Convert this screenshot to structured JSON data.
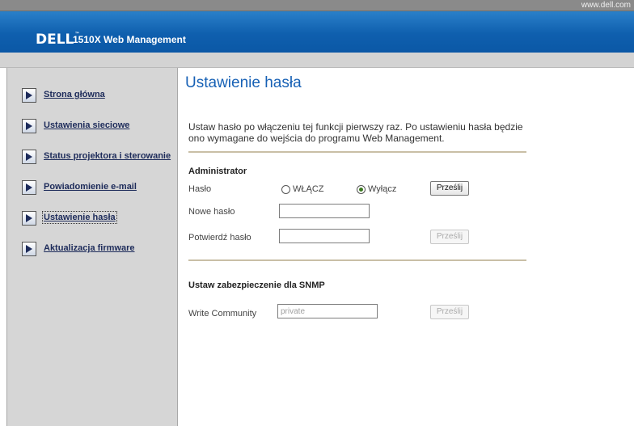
{
  "top_url": "www.dell.com",
  "header": {
    "logo_text": "DELL",
    "logo_tm": "™",
    "product_title": "1510X Web Management"
  },
  "sidebar": {
    "items": [
      {
        "label": "Strona główna"
      },
      {
        "label": "Ustawienia sieciowe"
      },
      {
        "label": "Status projektora i sterowanie"
      },
      {
        "label": "Powiadomienie e-mail"
      },
      {
        "label": "Ustawienie hasła",
        "active": true
      },
      {
        "label": "Aktualizacja firmware"
      }
    ]
  },
  "main": {
    "title": "Ustawienie hasła",
    "description": "Ustaw hasło po włączeniu tej funkcji pierwszy raz. Po ustawieniu hasła będzie ono wymagane do wejścia do programu Web Management.",
    "admin": {
      "section_title": "Administrator",
      "password_label": "Hasło",
      "radio_on": "WŁĄCZ",
      "radio_off": "Wyłącz",
      "selected": "Wyłącz",
      "submit_label": "Prześlij",
      "new_password_label": "Nowe hasło",
      "new_password_value": "",
      "confirm_password_label": "Potwierdź hasło",
      "confirm_password_value": "",
      "confirm_submit_label": "Prześlij"
    },
    "snmp": {
      "section_title": "Ustaw zabezpieczenie dla SNMP",
      "write_community_label": "Write Community",
      "write_community_value": "private",
      "submit_label": "Prześlij"
    }
  },
  "colors": {
    "header_blue": "#0f5fae",
    "title_blue": "#1761b5",
    "sidebar_bg": "#d6d6d6",
    "link_navy": "#1d2b5a",
    "separator": "#c9bfa6"
  }
}
